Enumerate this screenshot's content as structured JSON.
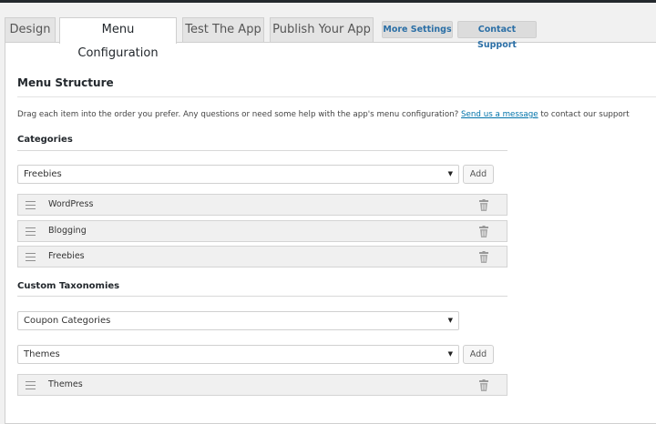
{
  "tabs": [
    {
      "label": "Design"
    },
    {
      "label": "Menu Configuration"
    },
    {
      "label": "Test The App"
    },
    {
      "label": "Publish Your App"
    }
  ],
  "buttons": {
    "more_settings": "More Settings",
    "contact_support": "Contact Support"
  },
  "menu_structure": {
    "title": "Menu Structure",
    "description_before": "Drag each item into the order you prefer. Any questions or need some help with the app's menu configuration? ",
    "description_link": "Send us a message",
    "description_after": " to contact our support"
  },
  "categories": {
    "title": "Categories",
    "selected": "Freebies",
    "add_label": "Add",
    "items": [
      {
        "label": "WordPress"
      },
      {
        "label": "Blogging"
      },
      {
        "label": "Freebies"
      }
    ]
  },
  "custom_taxonomies": {
    "title": "Custom Taxonomies",
    "taxonomy_selected": "Coupon Categories",
    "term_selected": "Themes",
    "add_label": "Add",
    "items": [
      {
        "label": "Themes"
      }
    ]
  }
}
